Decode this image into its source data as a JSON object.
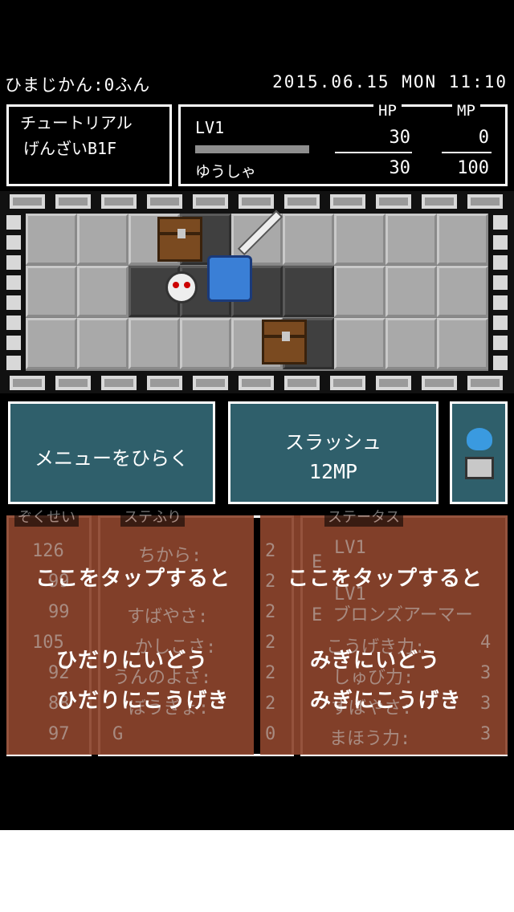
{
  "status_bar": {
    "elapsed": "ひまじかん:0ふん",
    "datetime": "2015.06.15 MON 11:10"
  },
  "location": {
    "line1": "チュートリアル",
    "line2": "げんざいB1F"
  },
  "player": {
    "level": "LV1",
    "name": "ゆうしゃ",
    "hp_label": "HP",
    "mp_label": "MP",
    "hp_current": "30",
    "hp_max": "30",
    "mp_current": "0",
    "mp_max": "100"
  },
  "buttons": {
    "menu": "メニューをひらく",
    "skill_name": "スラッシュ",
    "skill_cost": "12MP"
  },
  "panels_behind": {
    "attributes_title": "ぞくせい",
    "stat_alloc_title": "ステふり",
    "status_title": "ステータス",
    "attributes": [
      "126",
      "99",
      "99",
      "105",
      "92",
      "88",
      "97"
    ],
    "alloc_labels": [
      "ちから:",
      "",
      "すばやさ:",
      "かしこさ:",
      "うんのよさ:",
      "ぼうぎょ:",
      "G"
    ],
    "alloc_values": [
      "2",
      "2",
      "2",
      "2",
      "2",
      "2",
      "0"
    ],
    "status_lines": [
      "LV1",
      "E",
      "LV1",
      "E ブロンズアーマー",
      "こうげき力:",
      "しゅび力:",
      "すばやさ:",
      "まほう力:"
    ],
    "status_values": [
      "",
      "",
      "",
      "",
      "4",
      "3",
      "3",
      "3"
    ]
  },
  "tutorial_left": {
    "line1": "ここをタップすると",
    "line2": "ひだりにいどう",
    "line3": "ひだりにこうげき"
  },
  "tutorial_right": {
    "line1": "ここをタップすると",
    "line2": "みぎにいどう",
    "line3": "みぎにこうげき"
  },
  "colors": {
    "button_bg": "#2f5f6b",
    "overlay": "#8c442c",
    "hp_bar": "#8e8e8e"
  }
}
